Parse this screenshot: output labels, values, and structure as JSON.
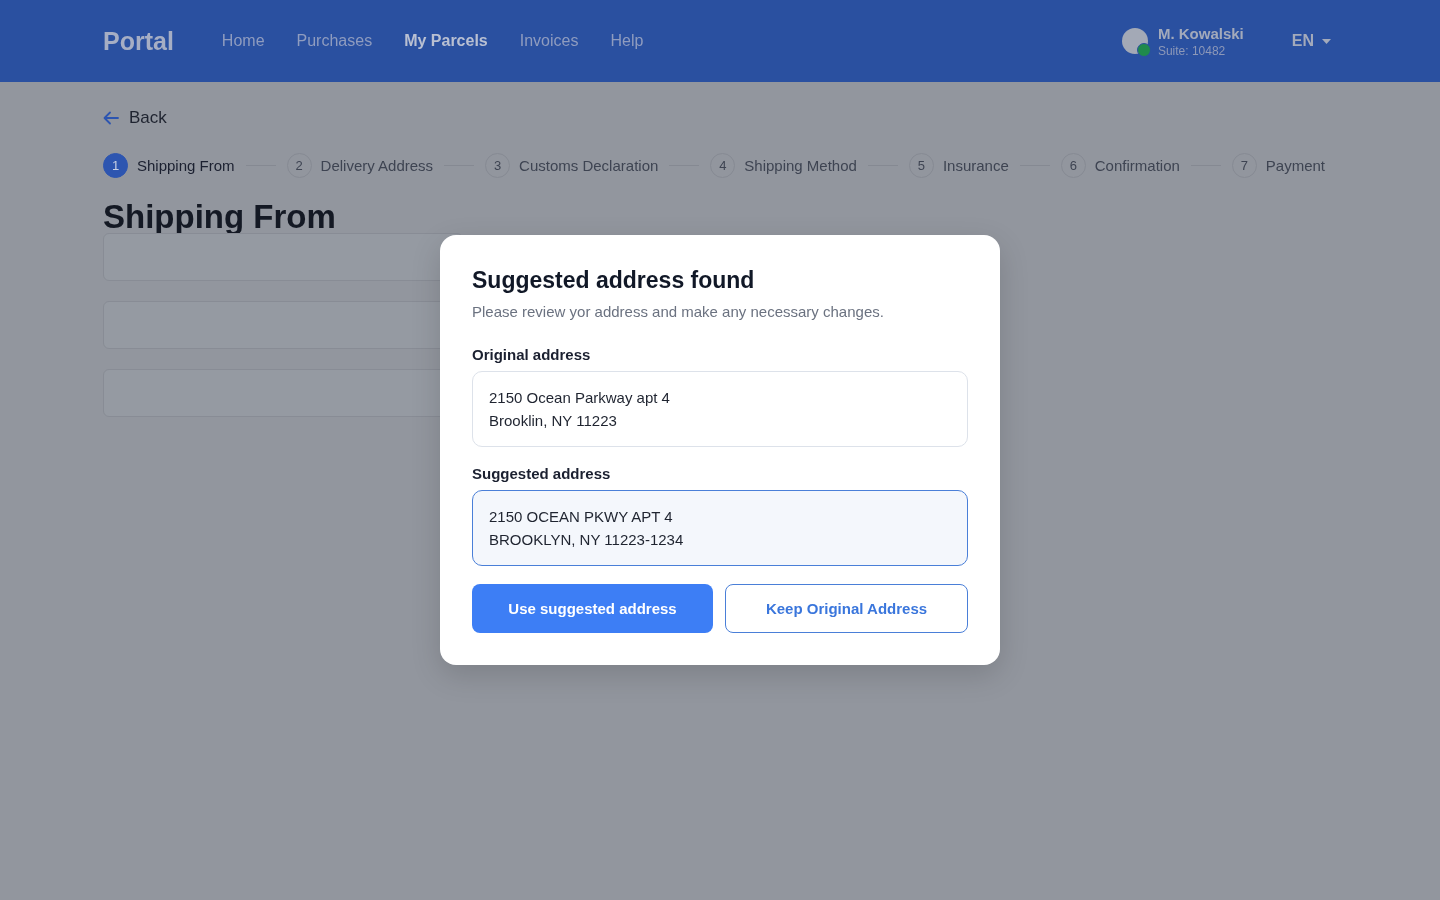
{
  "header": {
    "logo": "Portal",
    "nav": [
      {
        "label": "Home",
        "selected": false
      },
      {
        "label": "Purchases",
        "selected": false
      },
      {
        "label": "My Parcels",
        "selected": true
      },
      {
        "label": "Invoices",
        "selected": false
      },
      {
        "label": "Help",
        "selected": false
      }
    ],
    "user": {
      "name": "M. Kowalski",
      "suite": "Suite: 10482",
      "online": true
    },
    "language": "EN"
  },
  "back": "Back",
  "steps": [
    {
      "number": "1",
      "label": "Shipping From",
      "selected": true
    },
    {
      "number": "2",
      "label": "Delivery Address",
      "selected": false
    },
    {
      "number": "3",
      "label": "Customs Declaration",
      "selected": false
    },
    {
      "number": "4",
      "label": "Shipping Method",
      "selected": false
    },
    {
      "number": "5",
      "label": "Insurance",
      "selected": false
    },
    {
      "number": "6",
      "label": "Confirmation",
      "selected": false
    },
    {
      "number": "7",
      "label": "Payment",
      "selected": false
    }
  ],
  "heading": "Shipping From",
  "form_fields": [
    {
      "kind": "input"
    },
    {
      "kind": "input"
    },
    {
      "kind": "input"
    }
  ],
  "modal": {
    "title": "Suggested address found",
    "subtitle": "Please review yor address and make any necessary changes.",
    "options": [
      {
        "label": "Original address",
        "lines": [
          "2150 Ocean Parkway apt 4",
          "Brooklin, NY 11223"
        ],
        "selected": false
      },
      {
        "label": "Suggested address",
        "lines": [
          "2150 OCEAN PKWY APT 4",
          "BROOKLYN, NY 11223-1234"
        ],
        "selected": true
      }
    ],
    "buttons": [
      {
        "label": "Use suggested address",
        "kind": "primary"
      },
      {
        "label": "Keep Original Address",
        "kind": "secondary"
      }
    ]
  }
}
